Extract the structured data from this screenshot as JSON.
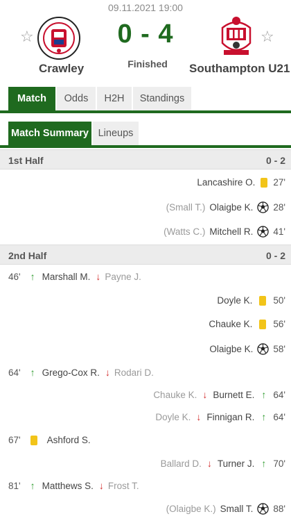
{
  "header": {
    "date": "09.11.2021 19:00",
    "home_team": "Crawley",
    "away_team": "Southampton U21",
    "score": "0 - 4",
    "status": "Finished",
    "star_glyph": "☆"
  },
  "tabs": [
    {
      "label": "Match",
      "active": true
    },
    {
      "label": "Odds",
      "active": false
    },
    {
      "label": "H2H",
      "active": false
    },
    {
      "label": "Standings",
      "active": false
    }
  ],
  "subtabs": [
    {
      "label": "Match Summary",
      "active": true
    },
    {
      "label": "Lineups",
      "active": false
    }
  ],
  "halves": [
    {
      "label": "1st Half",
      "result": "0 - 2"
    },
    {
      "label": "2nd Half",
      "result": "0 - 2"
    }
  ],
  "events": {
    "e1": {
      "minute": "27'",
      "player": "Lancashire O.",
      "type": "yellow-card"
    },
    "e2": {
      "minute": "28'",
      "player": "Olaigbe K.",
      "assist": "(Small T.)",
      "type": "goal"
    },
    "e3": {
      "minute": "41'",
      "player": "Mitchell R.",
      "assist": "(Watts C.)",
      "type": "goal"
    },
    "e4": {
      "minute": "46'",
      "player_in": "Marshall M.",
      "player_out": "Payne J.",
      "type": "substitution"
    },
    "e5": {
      "minute": "50'",
      "player": "Doyle K.",
      "type": "yellow-card"
    },
    "e6": {
      "minute": "56'",
      "player": "Chauke K.",
      "type": "yellow-card"
    },
    "e7": {
      "minute": "58'",
      "player": "Olaigbe K.",
      "type": "goal"
    },
    "e8": {
      "minute": "64'",
      "player_in": "Grego-Cox R.",
      "player_out": "Rodari D.",
      "type": "substitution"
    },
    "e9": {
      "minute": "64'",
      "player_in": "Burnett E.",
      "player_out": "Chauke K.",
      "type": "substitution"
    },
    "e10": {
      "minute": "64'",
      "player_in": "Finnigan R.",
      "player_out": "Doyle K.",
      "type": "substitution"
    },
    "e11": {
      "minute": "67'",
      "player": "Ashford S.",
      "type": "yellow-card"
    },
    "e12": {
      "minute": "70'",
      "player_in": "Turner J.",
      "player_out": "Ballard D.",
      "type": "substitution"
    },
    "e13": {
      "minute": "81'",
      "player_in": "Matthews S.",
      "player_out": "Frost T.",
      "type": "substitution"
    },
    "e14": {
      "minute": "88'",
      "player": "Small T.",
      "assist": "(Olaigbe K.)",
      "type": "goal"
    }
  },
  "icons": {
    "sub_in_glyph": "↑",
    "sub_out_glyph": "↓"
  },
  "colors": {
    "primary": "#1f6a1f",
    "card_yellow": "#f2c419",
    "sub_in": "#2e9b2e",
    "sub_out": "#d22b2b"
  }
}
